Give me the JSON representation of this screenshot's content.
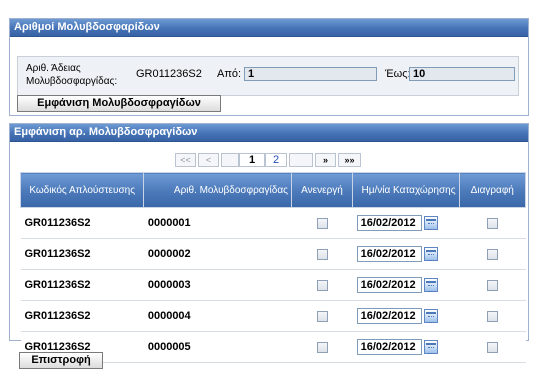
{
  "panel_license": {
    "title": "Αριθμοί Μολυβδοσφαρίδων",
    "license_label_line1": "Αριθ. Άδειας",
    "license_label_line2": "Μολυβδοσφαργίδας:",
    "license_value": "GR011236S2",
    "from_label": "Από:",
    "from_value": "1",
    "to_label": "Έως:",
    "to_value": "10",
    "show_button": "Εμφάνιση Μολυβδοσφραγίδων"
  },
  "panel_results": {
    "title": "Εμφάνιση αρ. Μολυβδοσφραγίδων",
    "pager": {
      "first": "<<",
      "prev": "<",
      "page1": "1",
      "page2": "2",
      "next": "»",
      "last": "»»"
    },
    "columns": {
      "code": "Κωδικός Απλούστευσης",
      "seal_no": "Αριθ. Μολυβδοσφραγίδας",
      "inactive": "Ανενεργή",
      "reg_date": "Ημ/νία Καταχώρησης",
      "delete": "Διαγραφή"
    },
    "rows": [
      {
        "code": "GR011236S2",
        "seal_no": "0000001",
        "date": "16/02/2012"
      },
      {
        "code": "GR011236S2",
        "seal_no": "0000002",
        "date": "16/02/2012"
      },
      {
        "code": "GR011236S2",
        "seal_no": "0000003",
        "date": "16/02/2012"
      },
      {
        "code": "GR011236S2",
        "seal_no": "0000004",
        "date": "16/02/2012"
      },
      {
        "code": "GR011236S2",
        "seal_no": "0000005",
        "date": "16/02/2012"
      }
    ]
  },
  "back_button": "Επιστροφή"
}
